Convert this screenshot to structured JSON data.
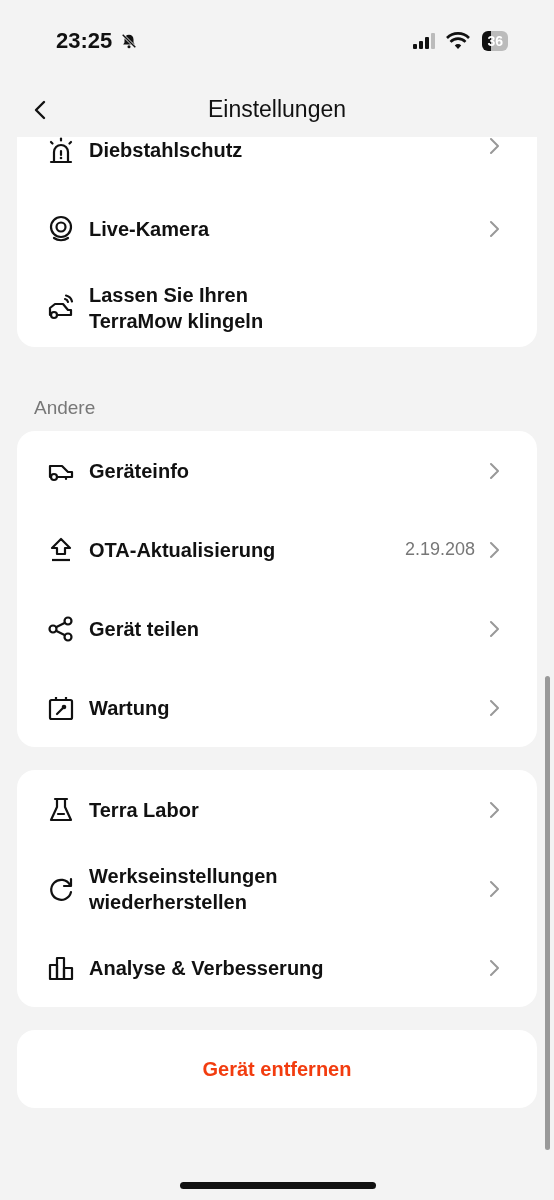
{
  "status_bar": {
    "time": "23:25",
    "silent": true,
    "battery": "36"
  },
  "header": {
    "title": "Einstellungen"
  },
  "sections": [
    {
      "items": [
        {
          "label": "Diebstahlschutz",
          "chevron": true
        },
        {
          "label": "Live-Kamera",
          "chevron": true
        },
        {
          "label": "Lassen Sie Ihren TerraMow klingeln",
          "chevron": false
        }
      ]
    },
    {
      "title": "Andere",
      "items": [
        {
          "label": "Geräteinfo",
          "chevron": true
        },
        {
          "label": "OTA-Aktualisierung",
          "value": "2.19.208",
          "chevron": true
        },
        {
          "label": "Gerät teilen",
          "chevron": true
        },
        {
          "label": "Wartung",
          "chevron": true
        }
      ]
    },
    {
      "items": [
        {
          "label": "Terra Labor",
          "chevron": true
        },
        {
          "label": "Werkseinstellungen wiederherstellen",
          "chevron": true
        },
        {
          "label": "Analyse & Verbesserung",
          "chevron": true
        }
      ]
    }
  ],
  "remove_button": "Gerät entfernen"
}
